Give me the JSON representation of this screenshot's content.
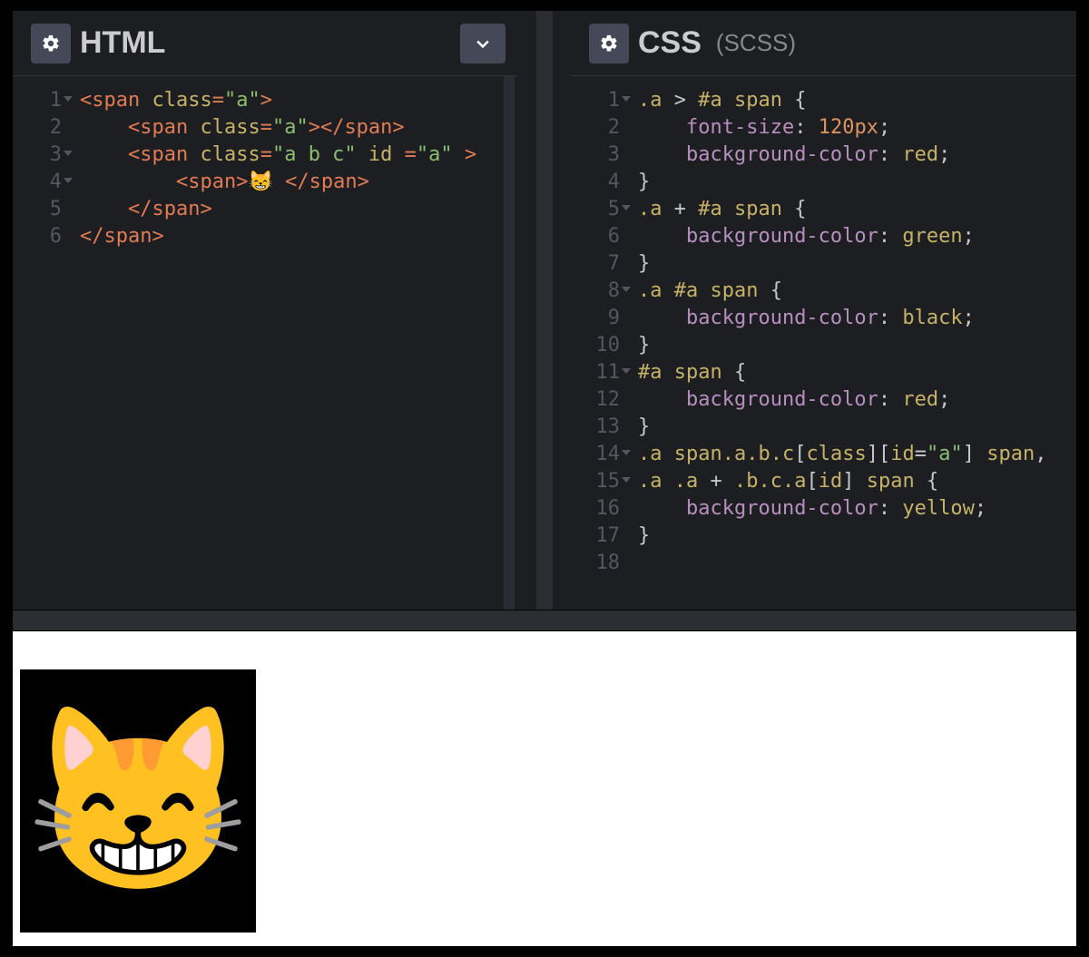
{
  "panels": {
    "html": {
      "title": "HTML",
      "subtitle": "",
      "gear_icon": "gear",
      "expand_icon": "chevron-down",
      "lines": [
        {
          "n": "1",
          "fold": true,
          "tokens": [
            [
              "tag",
              "<span "
            ],
            [
              "attr",
              "class"
            ],
            [
              "tag",
              "="
            ],
            [
              "str",
              "\"a\""
            ],
            [
              "tag",
              ">"
            ]
          ]
        },
        {
          "n": "2",
          "fold": false,
          "indent": "    ",
          "tokens": [
            [
              "tag",
              "<span "
            ],
            [
              "attr",
              "class"
            ],
            [
              "tag",
              "="
            ],
            [
              "str",
              "\"a\""
            ],
            [
              "tag",
              "></span>"
            ]
          ]
        },
        {
          "n": "3",
          "fold": true,
          "indent": "    ",
          "tokens": [
            [
              "tag",
              "<span "
            ],
            [
              "attr",
              "class"
            ],
            [
              "tag",
              "="
            ],
            [
              "str",
              "\"a b c\""
            ],
            [
              "tag",
              " "
            ],
            [
              "attr",
              "id"
            ],
            [
              "tag",
              " ="
            ],
            [
              "str",
              "\"a\""
            ],
            [
              "tag",
              " >"
            ]
          ]
        },
        {
          "n": "4",
          "fold": true,
          "indent": "        ",
          "tokens": [
            [
              "tag",
              "<span>"
            ],
            [
              "text",
              "😸 "
            ],
            [
              "tag",
              "</span>"
            ]
          ]
        },
        {
          "n": "5",
          "fold": false,
          "indent": "    ",
          "tokens": [
            [
              "tag",
              "</span>"
            ]
          ]
        },
        {
          "n": "6",
          "fold": false,
          "tokens": [
            [
              "tag",
              "</span>"
            ]
          ]
        }
      ]
    },
    "css": {
      "title": "CSS",
      "subtitle": "(SCSS)",
      "gear_icon": "gear",
      "lines": [
        {
          "n": "1",
          "fold": true,
          "tokens": [
            [
              "ylw",
              ".a"
            ],
            [
              "text",
              " > "
            ],
            [
              "ylw",
              "#a"
            ],
            [
              "text",
              " "
            ],
            [
              "attr",
              "span"
            ],
            [
              "text",
              " {"
            ]
          ]
        },
        {
          "n": "2",
          "fold": false,
          "indent": "    ",
          "tokens": [
            [
              "prop",
              "font-size"
            ],
            [
              "text",
              ": "
            ],
            [
              "num",
              "120px"
            ],
            [
              "text",
              ";"
            ]
          ]
        },
        {
          "n": "3",
          "fold": false,
          "indent": "    ",
          "tokens": [
            [
              "prop",
              "background-color"
            ],
            [
              "text",
              ": "
            ],
            [
              "attr",
              "red"
            ],
            [
              "text",
              ";"
            ]
          ]
        },
        {
          "n": "4",
          "fold": false,
          "tokens": [
            [
              "text",
              "}"
            ]
          ]
        },
        {
          "n": "5",
          "fold": true,
          "tokens": [
            [
              "ylw",
              ".a"
            ],
            [
              "text",
              " + "
            ],
            [
              "ylw",
              "#a"
            ],
            [
              "text",
              " "
            ],
            [
              "attr",
              "span"
            ],
            [
              "text",
              " {"
            ]
          ]
        },
        {
          "n": "6",
          "fold": false,
          "indent": "    ",
          "tokens": [
            [
              "prop",
              "background-color"
            ],
            [
              "text",
              ": "
            ],
            [
              "attr",
              "green"
            ],
            [
              "text",
              ";"
            ]
          ]
        },
        {
          "n": "7",
          "fold": false,
          "tokens": [
            [
              "text",
              "}"
            ]
          ]
        },
        {
          "n": "8",
          "fold": true,
          "tokens": [
            [
              "ylw",
              ".a"
            ],
            [
              "text",
              " "
            ],
            [
              "ylw",
              "#a"
            ],
            [
              "text",
              " "
            ],
            [
              "attr",
              "span"
            ],
            [
              "text",
              " {"
            ]
          ]
        },
        {
          "n": "9",
          "fold": false,
          "indent": "    ",
          "tokens": [
            [
              "prop",
              "background-color"
            ],
            [
              "text",
              ": "
            ],
            [
              "attr",
              "black"
            ],
            [
              "text",
              ";"
            ]
          ]
        },
        {
          "n": "10",
          "fold": false,
          "tokens": [
            [
              "text",
              "}"
            ]
          ]
        },
        {
          "n": "11",
          "fold": true,
          "tokens": [
            [
              "ylw",
              "#a"
            ],
            [
              "text",
              " "
            ],
            [
              "attr",
              "span"
            ],
            [
              "text",
              " {"
            ]
          ]
        },
        {
          "n": "12",
          "fold": false,
          "indent": "    ",
          "tokens": [
            [
              "prop",
              "background-color"
            ],
            [
              "text",
              ": "
            ],
            [
              "attr",
              "red"
            ],
            [
              "text",
              ";"
            ]
          ]
        },
        {
          "n": "13",
          "fold": false,
          "tokens": [
            [
              "text",
              "}"
            ]
          ]
        },
        {
          "n": "14",
          "fold": true,
          "tokens": [
            [
              "ylw",
              ".a"
            ],
            [
              "text",
              " "
            ],
            [
              "attr",
              "span"
            ],
            [
              "ylw",
              ".a.b.c"
            ],
            [
              "text",
              "["
            ],
            [
              "attr",
              "class"
            ],
            [
              "text",
              "]["
            ],
            [
              "attr",
              "id"
            ],
            [
              "text",
              "="
            ],
            [
              "str",
              "\"a\""
            ],
            [
              "text",
              "] "
            ],
            [
              "attr",
              "span"
            ],
            [
              "text",
              ","
            ]
          ]
        },
        {
          "n": "15",
          "fold": true,
          "tokens": [
            [
              "ylw",
              ".a"
            ],
            [
              "text",
              " "
            ],
            [
              "ylw",
              ".a"
            ],
            [
              "text",
              " + "
            ],
            [
              "ylw",
              ".b.c.a"
            ],
            [
              "text",
              "["
            ],
            [
              "attr",
              "id"
            ],
            [
              "text",
              "] "
            ],
            [
              "attr",
              "span"
            ],
            [
              "text",
              " {"
            ]
          ]
        },
        {
          "n": "16",
          "fold": false,
          "indent": "    ",
          "tokens": [
            [
              "prop",
              "background-color"
            ],
            [
              "text",
              ": "
            ],
            [
              "attr",
              "yellow"
            ],
            [
              "text",
              ";"
            ]
          ]
        },
        {
          "n": "17",
          "fold": false,
          "tokens": [
            [
              "text",
              "}"
            ]
          ]
        },
        {
          "n": "18",
          "fold": false,
          "tokens": []
        }
      ]
    }
  },
  "preview": {
    "emoji": "😸"
  }
}
